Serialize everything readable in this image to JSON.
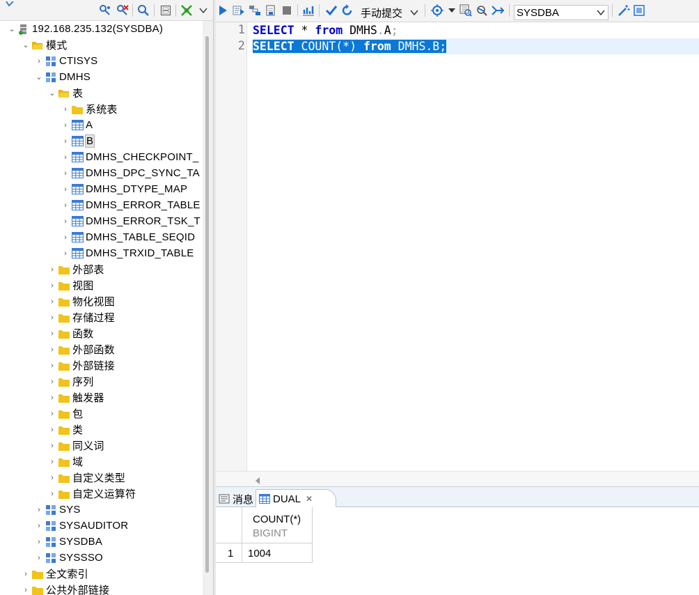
{
  "tree": {
    "connection": "192.168.235.132(SYSDBA)",
    "schemas_folder": "模式",
    "schemas": {
      "ctisys": "CTISYS",
      "dmhs": "DMHS",
      "sys": "SYS",
      "sysauditor": "SYSAUDITOR",
      "sysdba": "SYSDBA",
      "syssso": "SYSSSO"
    },
    "tables_folder": "表",
    "system_tables": "系统表",
    "tables": [
      "A",
      "B",
      "DMHS_CHECKPOINT_",
      "DMHS_DPC_SYNC_TA",
      "DMHS_DTYPE_MAP",
      "DMHS_ERROR_TABLE",
      "DMHS_ERROR_TSK_T",
      "DMHS_TABLE_SEQID",
      "DMHS_TRXID_TABLE"
    ],
    "folders": [
      "外部表",
      "视图",
      "物化视图",
      "存储过程",
      "函数",
      "外部函数",
      "外部链接",
      "序列",
      "触发器",
      "包",
      "类",
      "同义词",
      "域",
      "自定义类型",
      "自定义运算符"
    ],
    "fulltext": "全文索引",
    "public_links": "公共外部链接"
  },
  "toolbar": {
    "commit_mode": "手动提交",
    "schema": "SYSDBA"
  },
  "editor": {
    "line_numbers": [
      "1",
      "2"
    ],
    "line1": {
      "kw1": "SELECT",
      "star": " * ",
      "kw2": "from",
      "obj": " DMHS",
      "dot": ".",
      "tbl": "A",
      "semi": ";"
    },
    "line2": {
      "kw1": "SELECT",
      "func": " COUNT(*) ",
      "kw2": "from",
      "obj": " DMHS.B;"
    }
  },
  "results": {
    "tab_messages": "消息",
    "tab_result": "DUAL",
    "column_name": "COUNT(*)",
    "column_type": "BIGINT",
    "row_number": "1",
    "value": "1004"
  },
  "colors": {
    "keyword": "#0000d0",
    "selection": "#0a78d6",
    "folder": "#f2c318",
    "table_icon": "#3a7bd5",
    "run_icon": "#1f6fd1",
    "green_icon": "#2aa12a"
  }
}
